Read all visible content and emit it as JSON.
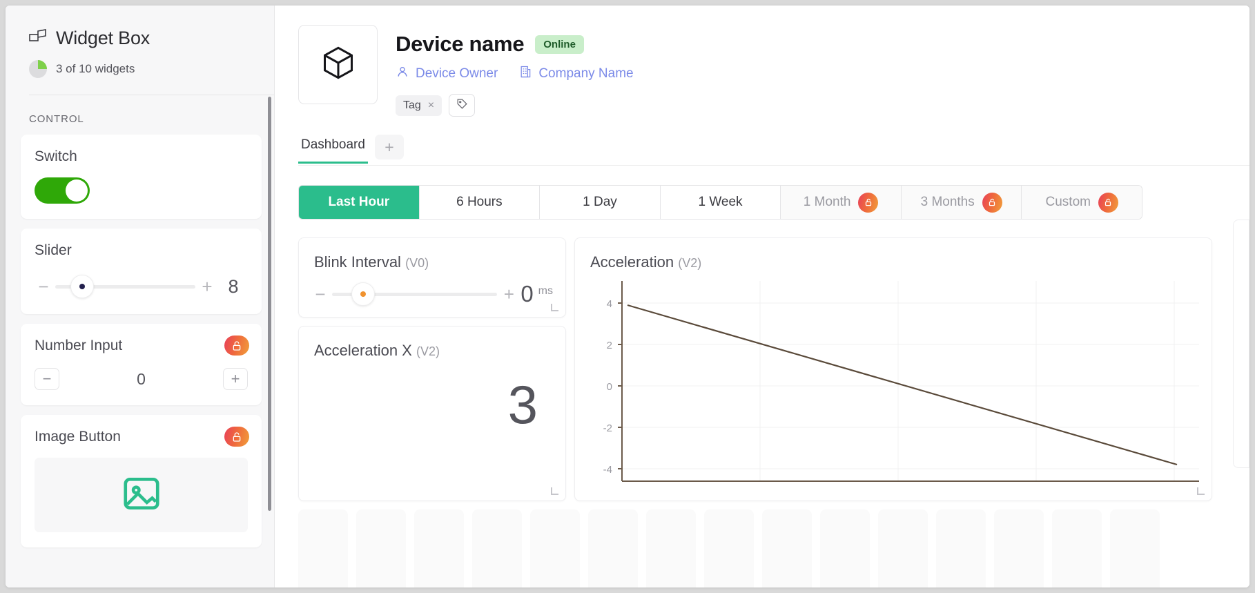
{
  "sidebar": {
    "title": "Widget Box",
    "title_icon": "widget-box-icon",
    "count_text": "3 of 10 widgets",
    "count_used": 3,
    "count_total": 10,
    "section_label": "CONTROL",
    "widgets": [
      {
        "title": "Switch",
        "type": "switch",
        "state": "on",
        "locked": false
      },
      {
        "title": "Slider",
        "type": "slider",
        "value": "8",
        "locked": false
      },
      {
        "title": "Number Input",
        "type": "number",
        "value": "0",
        "locked": true,
        "minus_label": "−",
        "plus_label": "+"
      },
      {
        "title": "Image Button",
        "type": "image",
        "locked": true,
        "image_icon": "image-icon"
      }
    ]
  },
  "device": {
    "name": "Device name",
    "status": "Online",
    "thumb_icon": "cube-icon",
    "owner": {
      "label": "Device Owner",
      "icon": "user-icon"
    },
    "company": {
      "label": "Company Name",
      "icon": "building-icon"
    },
    "tag": {
      "label": "Tag",
      "remove_label": "×"
    },
    "tag_add_icon": "tag-icon"
  },
  "dashboard": {
    "tab_label": "Dashboard",
    "add_tab_label": "+"
  },
  "ranges": {
    "items": [
      {
        "label": "Last Hour",
        "active": true,
        "locked": false
      },
      {
        "label": "6 Hours",
        "active": false,
        "locked": false
      },
      {
        "label": "1 Day",
        "active": false,
        "locked": false
      },
      {
        "label": "1 Week",
        "active": false,
        "locked": false
      },
      {
        "label": "1 Month",
        "active": false,
        "locked": true
      },
      {
        "label": "3 Months",
        "active": false,
        "locked": true
      },
      {
        "label": "Custom",
        "active": false,
        "locked": true
      }
    ]
  },
  "widgets": {
    "blink": {
      "title": "Blink Interval",
      "pin": "(V0)",
      "value": "0",
      "unit": "ms",
      "minus_label": "−",
      "plus_label": "+"
    },
    "accel_x": {
      "title": "Acceleration X",
      "pin": "(V2)",
      "value": "3"
    },
    "chart": {
      "title": "Acceleration",
      "pin": "(V2)"
    }
  },
  "chart_data": {
    "type": "line",
    "title": "Acceleration",
    "subtitle": "(V2)",
    "xlabel": "",
    "ylabel": "",
    "ylim": [
      -5,
      5.5
    ],
    "yticks": [
      4,
      2,
      0,
      -2,
      -4
    ],
    "ytick_labels": [
      "4",
      "2",
      "0",
      "-2",
      "-4"
    ],
    "grid": true,
    "legend": false,
    "line_color": "#5a4a3a",
    "axis_color": "#6b5a4a",
    "series": [
      {
        "name": "Acceleration",
        "x": [
          0.05,
          1.0
        ],
        "values": [
          3.9,
          -3.8
        ]
      }
    ]
  },
  "colors": {
    "accent_green": "#2bbd8c",
    "switch_green": "#2fa808",
    "lock_gradient_start": "#e8405a",
    "lock_gradient_end": "#f0a03a",
    "link_blue": "#7b8ae8",
    "status_green_bg": "#c9eeca"
  }
}
